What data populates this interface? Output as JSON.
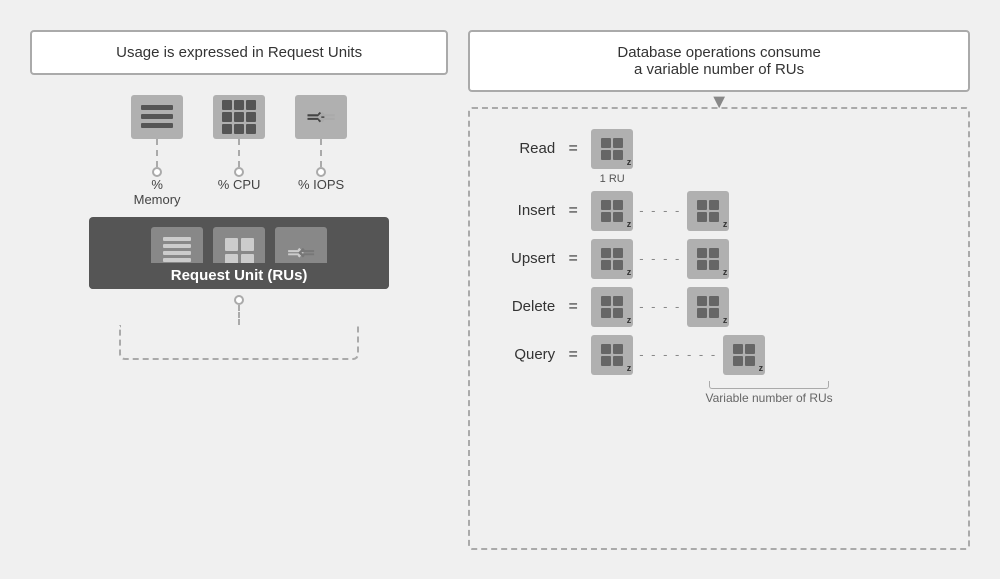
{
  "left": {
    "title": "Usage is expressed in Request Units",
    "resources": [
      {
        "label": "% Memory",
        "iconType": "memory"
      },
      {
        "label": "% CPU",
        "iconType": "cpu"
      },
      {
        "label": "% IOPS",
        "iconType": "iops"
      }
    ],
    "ru_label": "Request Unit (RUs)"
  },
  "right": {
    "title_line1": "Database operations consume",
    "title_line2": "a variable number of RUs",
    "operations": [
      {
        "label": "Read",
        "equals": "=",
        "count": 1,
        "ru_note": "1 RU"
      },
      {
        "label": "Insert",
        "equals": "=",
        "count": 2
      },
      {
        "label": "Upsert",
        "equals": "=",
        "count": 2
      },
      {
        "label": "Delete",
        "equals": "=",
        "count": 2
      },
      {
        "label": "Query",
        "equals": "=",
        "count": 2
      }
    ],
    "variable_label": "Variable number of RUs"
  }
}
